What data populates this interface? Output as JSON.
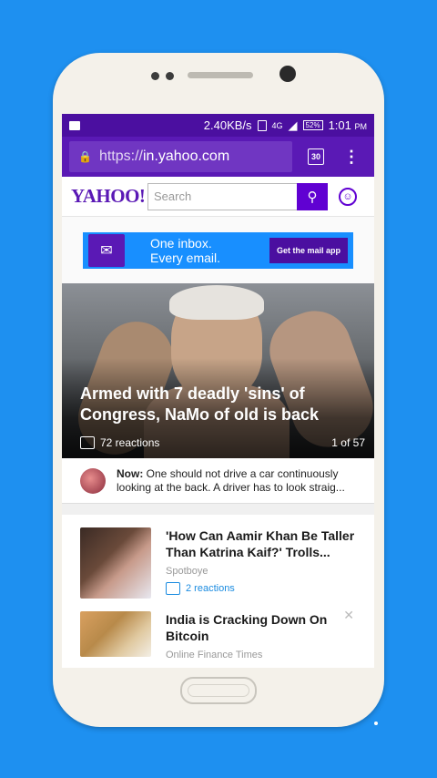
{
  "status_bar": {
    "speed": "2.40KB/s",
    "network": "4G",
    "battery": "52%",
    "time": "1:01",
    "ampm": "PM"
  },
  "browser": {
    "url_scheme": "https://",
    "url_host": "in.yahoo.com",
    "tab_count": "30"
  },
  "yahoo": {
    "logo": "YAHOO!",
    "search_placeholder": "Search"
  },
  "ad": {
    "line1": "One inbox.",
    "line2": "Every email.",
    "button": "Get the mail app",
    "icon_label": "YAHOO!"
  },
  "hero": {
    "title": "Armed with 7 deadly 'sins' of Congress, NaMo of old is back",
    "reactions": "72 reactions",
    "position": "1 of 57"
  },
  "now": {
    "label": "Now:",
    "text": "One should not drive a car continuously looking at the back. A driver has to look straig..."
  },
  "stories": [
    {
      "title": "'How Can Aamir Khan Be Taller Than Katrina Kaif?' Trolls...",
      "source": "Spotboye",
      "reactions": "2 reactions"
    },
    {
      "title": "India is Cracking Down On Bitcoin",
      "source": "Online Finance Times"
    }
  ]
}
